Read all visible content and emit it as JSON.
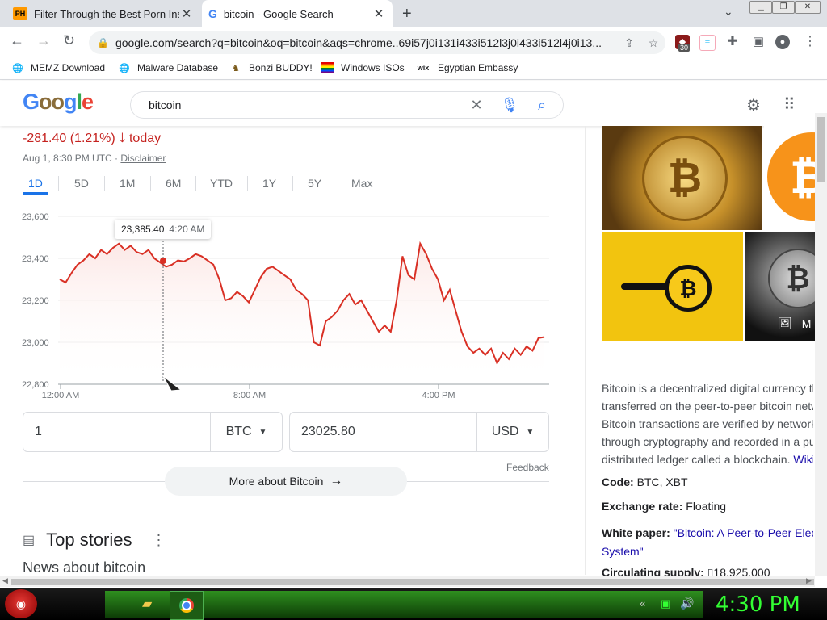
{
  "browser": {
    "tabs": [
      {
        "title": "Filter Through the Best Porn Insid",
        "favicon": "PH",
        "active": false
      },
      {
        "title": "bitcoin - Google Search",
        "favicon": "G",
        "active": true
      }
    ],
    "new_tab_label": "+",
    "url": "google.com/search?q=bitcoin&oq=bitcoin&aqs=chrome..69i57j0i131i433i512l3j0i433i512l4j0i13...",
    "extension_badge": "30",
    "bookmarks": [
      "MEMZ Download",
      "Malware Database",
      "Bonzi BUDDY!",
      "Windows ISOs",
      "Egyptian Embassy"
    ]
  },
  "google": {
    "logo_text": "Google",
    "query": "bitcoin"
  },
  "finance": {
    "change": "-281.40 (1.21%)",
    "change_suffix": "today",
    "timestamp": "Aug 1, 8:30 PM UTC · ",
    "disclaimer": "Disclaimer",
    "ranges": [
      "1D",
      "5D",
      "1M",
      "6M",
      "YTD",
      "1Y",
      "5Y",
      "Max"
    ],
    "selected_range": "1D",
    "tooltip_value": "23,385.40",
    "tooltip_time": "4:20 AM",
    "converter": {
      "from_amount": "1",
      "from_currency": "BTC",
      "to_amount": "23025.80",
      "to_currency": "USD"
    },
    "feedback": "Feedback",
    "more_button": "More about Bitcoin"
  },
  "chart_data": {
    "type": "line",
    "ylim": [
      22800,
      23600
    ],
    "yticks": [
      "23,600",
      "23,400",
      "23,200",
      "23,000",
      "22,800"
    ],
    "xticks": [
      "12:00 AM",
      "8:00 AM",
      "4:00 PM"
    ],
    "series": [
      {
        "values": [
          23300,
          23285,
          23330,
          23370,
          23390,
          23420,
          23400,
          23440,
          23420,
          23450,
          23470,
          23440,
          23460,
          23430,
          23420,
          23440,
          23400,
          23380,
          23360,
          23370,
          23390,
          23385,
          23400,
          23420,
          23410,
          23390,
          23370,
          23300,
          23200,
          23210,
          23240,
          23220,
          23190,
          23250,
          23310,
          23350,
          23360,
          23340,
          23320,
          23300,
          23250,
          23230,
          23200,
          23000,
          22985,
          23100,
          23120,
          23150,
          23200,
          23230,
          23180,
          23200,
          23150,
          23100,
          23050,
          23080,
          23050,
          23200,
          23410,
          23320,
          23300,
          23470,
          23420,
          23350,
          23300,
          23200,
          23250,
          23150,
          23050,
          22980,
          22950,
          22970,
          22940,
          22970,
          22900,
          22950,
          22920,
          22970,
          22940,
          22980,
          22960,
          23020,
          23025
        ]
      }
    ],
    "grid": true
  },
  "stories": {
    "heading": "Top stories",
    "subheading": "News about bitcoin"
  },
  "knowledge": {
    "description": [
      "Bitcoin is a decentralized digital currency th",
      "transferred on the peer-to-peer bitcoin netw",
      "Bitcoin transactions are verified by network",
      "through cryptography and recorded in a pu",
      "distributed ledger called a blockchain."
    ],
    "wiki_link": "Wiki",
    "code_label": "Code:",
    "code_value": "BTC, XBT",
    "rate_label": "Exchange rate:",
    "rate_value": "Floating",
    "paper_label": "White paper:",
    "paper_value": "\"Bitcoin: A Peer-to-Peer Elect",
    "paper_value_2": "System\"",
    "supply_label": "Circulating supply:",
    "supply_value": "18,925,000",
    "images_more": "M"
  },
  "taskbar": {
    "clock": "4:30 PM"
  },
  "colors": {
    "accent": "#1a73e8",
    "down": "#c5221f",
    "chart_line": "#d93025",
    "clock": "#33ff33"
  }
}
